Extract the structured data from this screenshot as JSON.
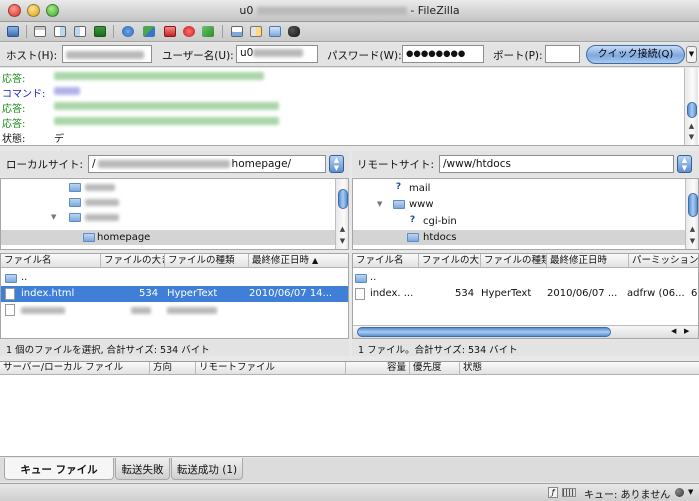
{
  "window": {
    "title_prefix": "u0",
    "title_suffix": "- FileZilla"
  },
  "toolbar": {
    "icons": [
      "site-manager-icon",
      "toggle-log-icon",
      "toggle-local-tree-icon",
      "toggle-remote-tree-icon",
      "refresh-icon",
      "process-queue-icon",
      "cancel-icon",
      "disconnect-icon",
      "reconnect-icon",
      "directory-listing-filter-icon",
      "compare-icon",
      "sync-browse-icon",
      "search-icon"
    ]
  },
  "quickconnect": {
    "host_label": "ホスト(H):",
    "user_label": "ユーザー名(U):",
    "user_value": "u0",
    "password_label": "パスワード(W):",
    "password_value": "●●●●●●●●",
    "port_label": "ポート(P):",
    "port_value": "",
    "connect_button": "クイック接続(Q)",
    "dropdown_glyph": "▼"
  },
  "log": {
    "rows": [
      {
        "label": "応答:",
        "color": "#1a8a1a"
      },
      {
        "label": "コマンド:",
        "color": "#1a1acc"
      },
      {
        "label": "応答:",
        "color": "#1a8a1a"
      },
      {
        "label": "応答:",
        "color": "#1a8a1a"
      },
      {
        "label": "状態:",
        "color": "#111111",
        "message": "ディレクトリー一覧の表示成功"
      }
    ]
  },
  "local": {
    "label": "ローカルサイト:",
    "path_start": "/",
    "path_end": "homepage/",
    "tree": [
      {
        "name": "",
        "indent": 70,
        "blurred": true
      },
      {
        "name": "",
        "indent": 70,
        "blurred": true
      },
      {
        "name": "",
        "indent": 70,
        "blurred": true,
        "expanded": true
      },
      {
        "name": "homepage",
        "indent": 82,
        "selected": true
      }
    ],
    "columns": [
      "ファイル名",
      "ファイルの大きさ",
      "ファイルの種類",
      "最終修正日時"
    ],
    "sort_indicator": "▲",
    "files": [
      {
        "name": "..",
        "size": "",
        "type": "",
        "modified": "",
        "icon": "folder"
      },
      {
        "name": "index.html",
        "size": "534",
        "type": "HyperText",
        "modified": "2010/06/07 14...",
        "icon": "file",
        "selected": true
      },
      {
        "name": "",
        "size": "",
        "type": "",
        "modified": "",
        "icon": "file",
        "blurred": true
      }
    ],
    "status": "1 個のファイルを選択, 合計サイズ: 534 バイト"
  },
  "remote": {
    "label": "リモートサイト:",
    "path": "/www/htdocs",
    "tree": [
      {
        "name": "mail",
        "indent": 40,
        "icon": "unknown"
      },
      {
        "name": "www",
        "indent": 40,
        "icon": "folder",
        "expanded": true
      },
      {
        "name": "cgi-bin",
        "indent": 54,
        "icon": "unknown"
      },
      {
        "name": "htdocs",
        "indent": 54,
        "icon": "folder",
        "selected": true
      }
    ],
    "columns": [
      "ファイル名",
      "ファイルの大きさ",
      "ファイルの種類",
      "最終修正日時",
      "パーミッション"
    ],
    "files": [
      {
        "name": "..",
        "size": "",
        "type": "",
        "modified": "",
        "perm": "",
        "icon": "folder"
      },
      {
        "name": "index. ...",
        "size": "534",
        "type": "HyperText",
        "modified": "2010/06/07 ...",
        "perm": "adfrw (06...",
        "tail": "6",
        "icon": "file"
      }
    ],
    "status": "1 ファイル。合計サイズ: 534 バイト"
  },
  "queue": {
    "columns": [
      "サーバー/ローカル ファイル",
      "方向",
      "リモートファイル",
      "容量",
      "優先度",
      "状態"
    ],
    "tabs": [
      "キュー ファイル",
      "転送失敗",
      "転送成功 (1)"
    ]
  },
  "statusbar": {
    "queue_text": "キュー: ありません"
  }
}
